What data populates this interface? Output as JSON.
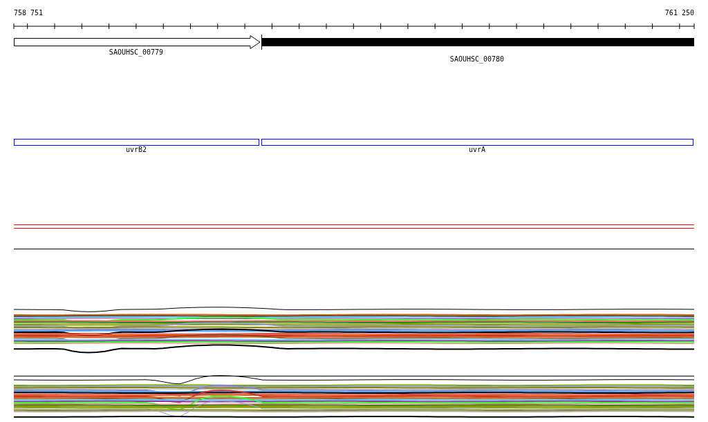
{
  "ruler": {
    "start_label": "758 751",
    "end_label": "761 250"
  },
  "genes": [
    {
      "label": "SAOUHSC_00779",
      "kind": "outline-arrow"
    },
    {
      "label": "SAOUHSC_00780",
      "kind": "filled"
    }
  ],
  "features": [
    {
      "label": "uvrB2",
      "color": "#0000ff"
    },
    {
      "label": "uvrA",
      "color": "#0000ff"
    }
  ]
}
